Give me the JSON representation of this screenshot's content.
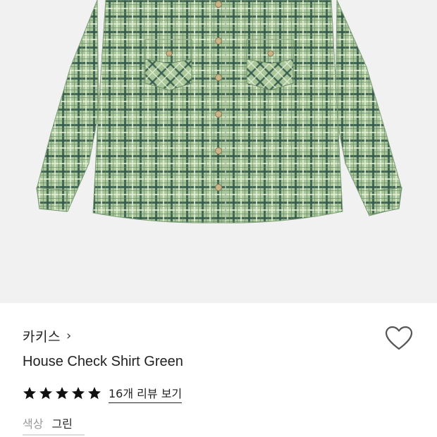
{
  "product": {
    "brand": "카키스",
    "brand_chevron": "›",
    "name": "House Check Shirt Green",
    "rating": 5,
    "review_link": "16개 리뷰 보기",
    "color_label": "색상",
    "color_value": "그린"
  },
  "icons": {
    "wishlist": "heart-outline-icon",
    "star": "star-filled-icon"
  },
  "colors": {
    "image_bg": "#f1f1f1",
    "shirt_base": "#a9c79a",
    "check_dark": "#33574a",
    "check_light": "#e6f0d8",
    "text_primary": "#222222",
    "text_secondary": "#999999"
  }
}
